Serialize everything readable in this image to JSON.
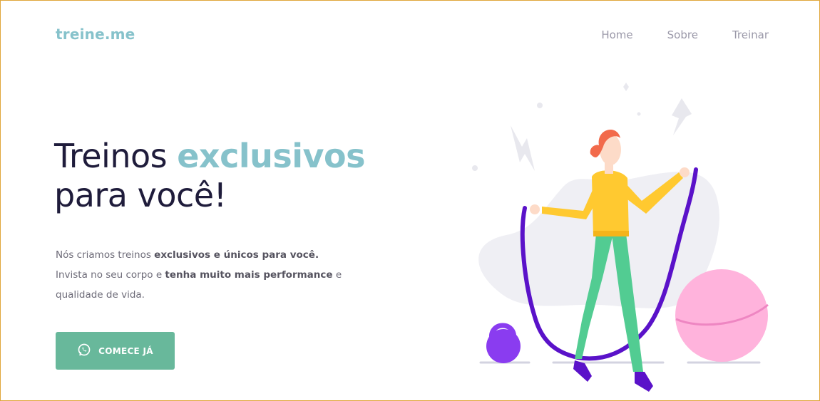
{
  "header": {
    "logo": "treine.me",
    "nav": [
      {
        "label": "Home"
      },
      {
        "label": "Sobre"
      },
      {
        "label": "Treinar"
      }
    ]
  },
  "hero": {
    "title_part1": "Treinos ",
    "title_accent": "exclusivos",
    "title_part2": "para você!",
    "line1_plain": "Nós criamos treinos ",
    "line1_bold": "exclusivos e únicos para você.",
    "line2_plain": "Invista no seu corpo e ",
    "line2_bold": "tenha muito mais performance",
    "line2_tail": " e",
    "line3": "qualidade de vida.",
    "cta_label": "COMECE JÁ",
    "cta_icon": "whatsapp-icon"
  },
  "colors": {
    "accent": "#86c2cb",
    "button": "#68b89b",
    "heading": "#1f1c3b",
    "frame": "#e0a63a"
  }
}
